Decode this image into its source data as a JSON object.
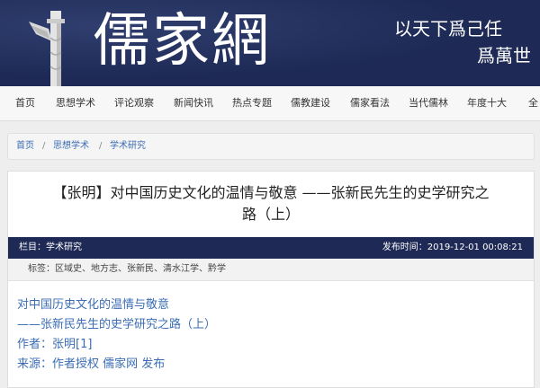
{
  "header": {
    "logo_text": "儒家網",
    "slogan_line1": "以天下爲己任",
    "slogan_line2": "爲萬世"
  },
  "nav": {
    "items": [
      "首页",
      "思想学术",
      "评论观察",
      "新闻快讯",
      "热点专题",
      "儒教建设",
      "儒家看法",
      "当代儒林",
      "年度十大",
      "全"
    ]
  },
  "breadcrumb": {
    "items": [
      "首页",
      "思想学术",
      "学术研究"
    ],
    "separator": "/"
  },
  "article": {
    "title_line1": "【张明】对中国历史文化的温情与敬意 ——张新民先生的史学研究之",
    "title_line2": "路（上）",
    "column_label": "栏目：学术研究",
    "publish_label": "发布时间：2019-12-01 00:08:21",
    "tags_line": "标签：区域史、地方志、张新民、清水江学、黔学",
    "body_lines": [
      "对中国历史文化的温情与敬意",
      "——张新民先生的史学研究之路（上）",
      "作者：张明[1]",
      "来源：作者授权 儒家网 发布"
    ]
  },
  "colors": {
    "banner_bg": "#1e2a55",
    "meta_bar_bg": "#1e2a55",
    "link_blue": "#3b6db3",
    "nav_bg": "#f7f7f7"
  }
}
